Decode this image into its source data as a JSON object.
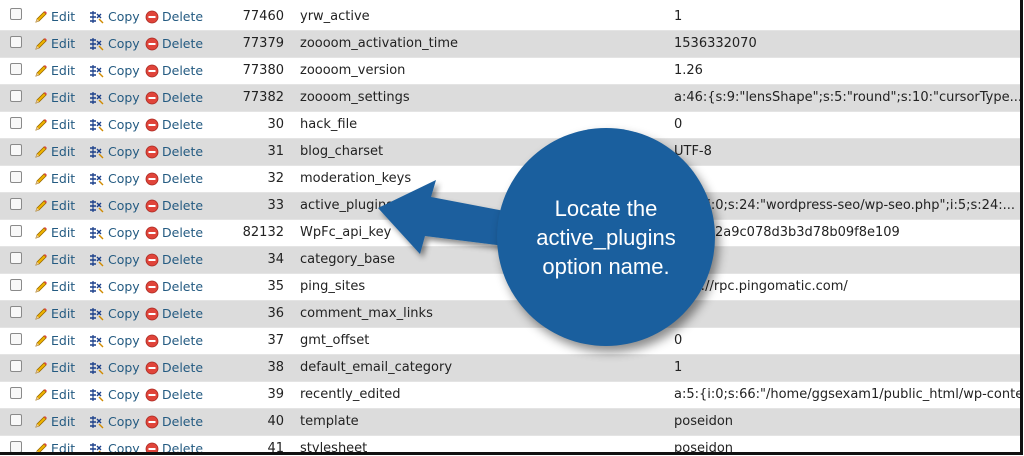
{
  "actions": {
    "edit": "Edit",
    "copy": "Copy",
    "delete": "Delete"
  },
  "rows": [
    {
      "id": "77460",
      "name": "yrw_active",
      "value": "1"
    },
    {
      "id": "77379",
      "name": "zoooom_activation_time",
      "value": "1536332070"
    },
    {
      "id": "77380",
      "name": "zoooom_version",
      "value": "1.26"
    },
    {
      "id": "77382",
      "name": "zoooom_settings",
      "value": "a:46:{s:9:\"lensShape\";s:5:\"round\";s:10:\"cursorType..."
    },
    {
      "id": "30",
      "name": "hack_file",
      "value": "0"
    },
    {
      "id": "31",
      "name": "blog_charset",
      "value": "UTF-8"
    },
    {
      "id": "32",
      "name": "moderation_keys",
      "value": ""
    },
    {
      "id": "33",
      "name": "active_plugins",
      "value": "a:5:{i:0;s:24:\"wordpress-seo/wp-seo.php\";i:5;s:24:..."
    },
    {
      "id": "82132",
      "name": "WpFc_api_key",
      "value": "b03a62a9c078d3b3d78b09f8e109"
    },
    {
      "id": "34",
      "name": "category_base",
      "value": ""
    },
    {
      "id": "35",
      "name": "ping_sites",
      "value": "http://rpc.pingomatic.com/"
    },
    {
      "id": "36",
      "name": "comment_max_links",
      "value": ""
    },
    {
      "id": "37",
      "name": "gmt_offset",
      "value": "0"
    },
    {
      "id": "38",
      "name": "default_email_category",
      "value": "1"
    },
    {
      "id": "39",
      "name": "recently_edited",
      "value": "a:5:{i:0;s:66:\"/home/ggsexam1/public_html/wp-conte..."
    },
    {
      "id": "40",
      "name": "template",
      "value": "poseidon"
    },
    {
      "id": "41",
      "name": "stylesheet",
      "value": "poseidon"
    }
  ],
  "callout": {
    "text": "Locate the active_plugins option name."
  }
}
